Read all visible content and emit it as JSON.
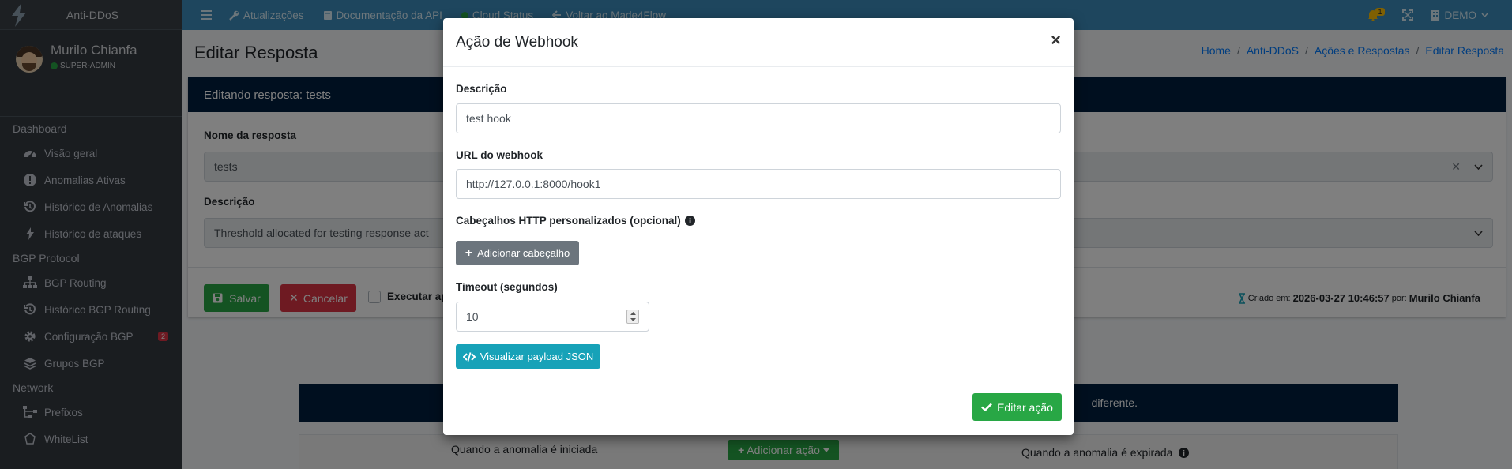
{
  "sidebar": {
    "brand": "Anti-DDoS",
    "user_name": "Murilo Chianfa",
    "user_role": "SUPER-ADMIN",
    "sections": [
      {
        "title": "Dashboard",
        "items": [
          {
            "label": "Visão geral",
            "icon": "dashboard-icon"
          },
          {
            "label": "Anomalias Ativas",
            "icon": "alert-circle-icon"
          },
          {
            "label": "Histórico de Anomalias",
            "icon": "history-icon"
          },
          {
            "label": "Histórico de ataques",
            "icon": "bolt-icon"
          }
        ]
      },
      {
        "title": "BGP Protocol",
        "items": [
          {
            "label": "BGP Routing",
            "icon": "sitemap-icon"
          },
          {
            "label": "Histórico BGP Routing",
            "icon": "history-icon"
          },
          {
            "label": "Configuração BGP",
            "icon": "gear-icon",
            "badge": "2"
          },
          {
            "label": "Grupos BGP",
            "icon": "layers-icon"
          }
        ]
      },
      {
        "title": "Network",
        "items": [
          {
            "label": "Prefixos",
            "icon": "network-icon"
          },
          {
            "label": "WhiteList",
            "icon": "shield-icon"
          }
        ]
      }
    ]
  },
  "topbar": {
    "items": [
      {
        "label": "Atualizações",
        "icon": "wrench-icon"
      },
      {
        "label": "Documentação da API",
        "icon": "book-icon"
      },
      {
        "label": "Cloud Status",
        "icon": "status-dot-icon"
      },
      {
        "label": "Voltar ao Made4Flow",
        "icon": "arrow-left-icon"
      }
    ],
    "notifications": "1",
    "account": "DEMO"
  },
  "page": {
    "title": "Editar Resposta",
    "breadcrumb": [
      "Home",
      "Anti-DDoS",
      "Ações e Respostas",
      "Editar Resposta"
    ],
    "breadcrumb_sep": "/",
    "card_header": "Editando resposta: tests",
    "name_label": "Nome da resposta",
    "name_value": "tests",
    "desc_label": "Descrição",
    "desc_value": "Threshold allocated for testing response act",
    "save": "Salvar",
    "cancel": "Cancelar",
    "execute_label": "Executar apó",
    "created_label": "Criado em:",
    "created_date": "2026-03-27 10:46:57",
    "created_by_label": "por:",
    "created_by": "Murilo Chianfa",
    "alert_text": "diferente.",
    "col_started": "Quando a anomalia é iniciada",
    "col_expired": "Quando a anomalia é expirada",
    "add_action": "Adicionar ação"
  },
  "modal": {
    "title": "Ação de Webhook",
    "close": "×",
    "desc_label": "Descrição",
    "desc_value": "test hook",
    "url_label": "URL do webhook",
    "url_value": "http://127.0.0.1:8000/hook1",
    "headers_label": "Cabeçalhos HTTP personalizados (opcional)",
    "add_header": "Adicionar cabeçalho",
    "timeout_label": "Timeout (segundos)",
    "timeout_value": "10",
    "view_payload": "Visualizar payload JSON",
    "submit": "Editar ação"
  },
  "colors": {
    "topbar": "#3c8dbc",
    "sidebar": "#343a40",
    "navy": "#001f3f",
    "success": "#28a745",
    "danger": "#dc3545",
    "info": "#17a2b8",
    "secondary": "#6c757d"
  }
}
